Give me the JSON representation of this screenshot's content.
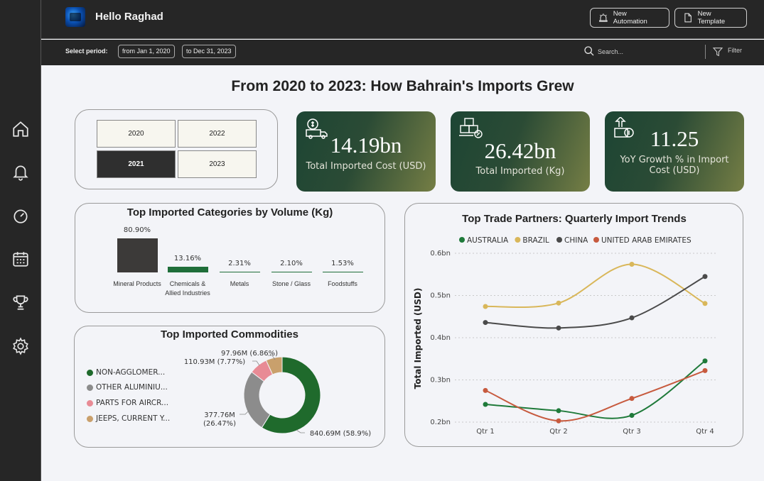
{
  "header": {
    "greeting": "Hello Raghad",
    "new_automation": "New Automation",
    "new_template": "New Template"
  },
  "filterbar": {
    "period_label": "Select period:",
    "from": "from Jan 1, 2020",
    "to": "to Dec 31, 2023",
    "search_placeholder": "Search...",
    "filter_label": "Filter"
  },
  "sidebar": {
    "icons": [
      "home-icon",
      "bell-icon",
      "gauge-icon",
      "calendar-icon",
      "trophy-icon",
      "settings-icon"
    ]
  },
  "page_title": "From 2020 to 2023: How Bahrain's Imports Grew",
  "years": {
    "options": [
      "2020",
      "2022",
      "2021",
      "2023"
    ],
    "selected": "2021"
  },
  "kpis": [
    {
      "value": "14.19bn",
      "label": "Total Imported Cost (USD)"
    },
    {
      "value": "26.42bn",
      "label": "Total Imported (Kg)"
    },
    {
      "value": "11.25",
      "label": "YoY Growth % in Import Cost (USD)"
    }
  ],
  "categories": {
    "title": "Top Imported Categories by Volume (Kg)",
    "items": [
      {
        "name": "Mineral Products",
        "value": 80.9,
        "label": "80.90%"
      },
      {
        "name": "Chemicals & Allied Industries",
        "value": 13.16,
        "label": "13.16%"
      },
      {
        "name": "Metals",
        "value": 2.31,
        "label": "2.31%"
      },
      {
        "name": "Stone / Glass",
        "value": 2.1,
        "label": "2.10%"
      },
      {
        "name": "Foodstuffs",
        "value": 1.53,
        "label": "1.53%"
      }
    ]
  },
  "commodities": {
    "title": "Top Imported Commodities",
    "legend": [
      {
        "name": "NON-AGGLOMER...",
        "color": "#1f6a2c"
      },
      {
        "name": "OTHER ALUMINIU...",
        "color": "#8c8c8c"
      },
      {
        "name": "PARTS FOR AIRCR...",
        "color": "#e88b95"
      },
      {
        "name": "JEEPS, CURRENT Y...",
        "color": "#c9a06c"
      }
    ],
    "labels": {
      "slice1": "840.69M (58.9%)",
      "slice2_line1": "377.76M",
      "slice2_line2": "(26.47%)",
      "slice3": "110.93M (7.77%)",
      "slice4": "97.96M (6.86%)"
    }
  },
  "chart_data": {
    "type": "line",
    "title": "Top Trade Partners: Quarterly Import Trends",
    "ylabel": "Total Imported (USD)",
    "xlabel": "",
    "categories": [
      "Qtr 1",
      "Qtr 2",
      "Qtr 3",
      "Qtr 4"
    ],
    "ylim": [
      0.2,
      0.6
    ],
    "yticks": [
      "0.2bn",
      "0.3bn",
      "0.4bn",
      "0.5bn",
      "0.6bn"
    ],
    "legend_position": "top",
    "series": [
      {
        "name": "AUSTRALIA",
        "color": "#1f7a3a",
        "values": [
          0.242,
          0.227,
          0.216,
          0.345
        ]
      },
      {
        "name": "BRAZIL",
        "color": "#d9b75a",
        "values": [
          0.474,
          0.482,
          0.574,
          0.481
        ]
      },
      {
        "name": "CHINA",
        "color": "#4a4a4a",
        "values": [
          0.436,
          0.423,
          0.447,
          0.545
        ]
      },
      {
        "name": "UNITED ARAB EMIRATES",
        "color": "#c75a3e",
        "values": [
          0.275,
          0.203,
          0.256,
          0.322
        ]
      }
    ]
  },
  "commodity_chart": {
    "type": "pie",
    "values": [
      840.69,
      377.76,
      110.93,
      97.96
    ],
    "percents": [
      58.9,
      26.47,
      7.77,
      6.86
    ]
  }
}
